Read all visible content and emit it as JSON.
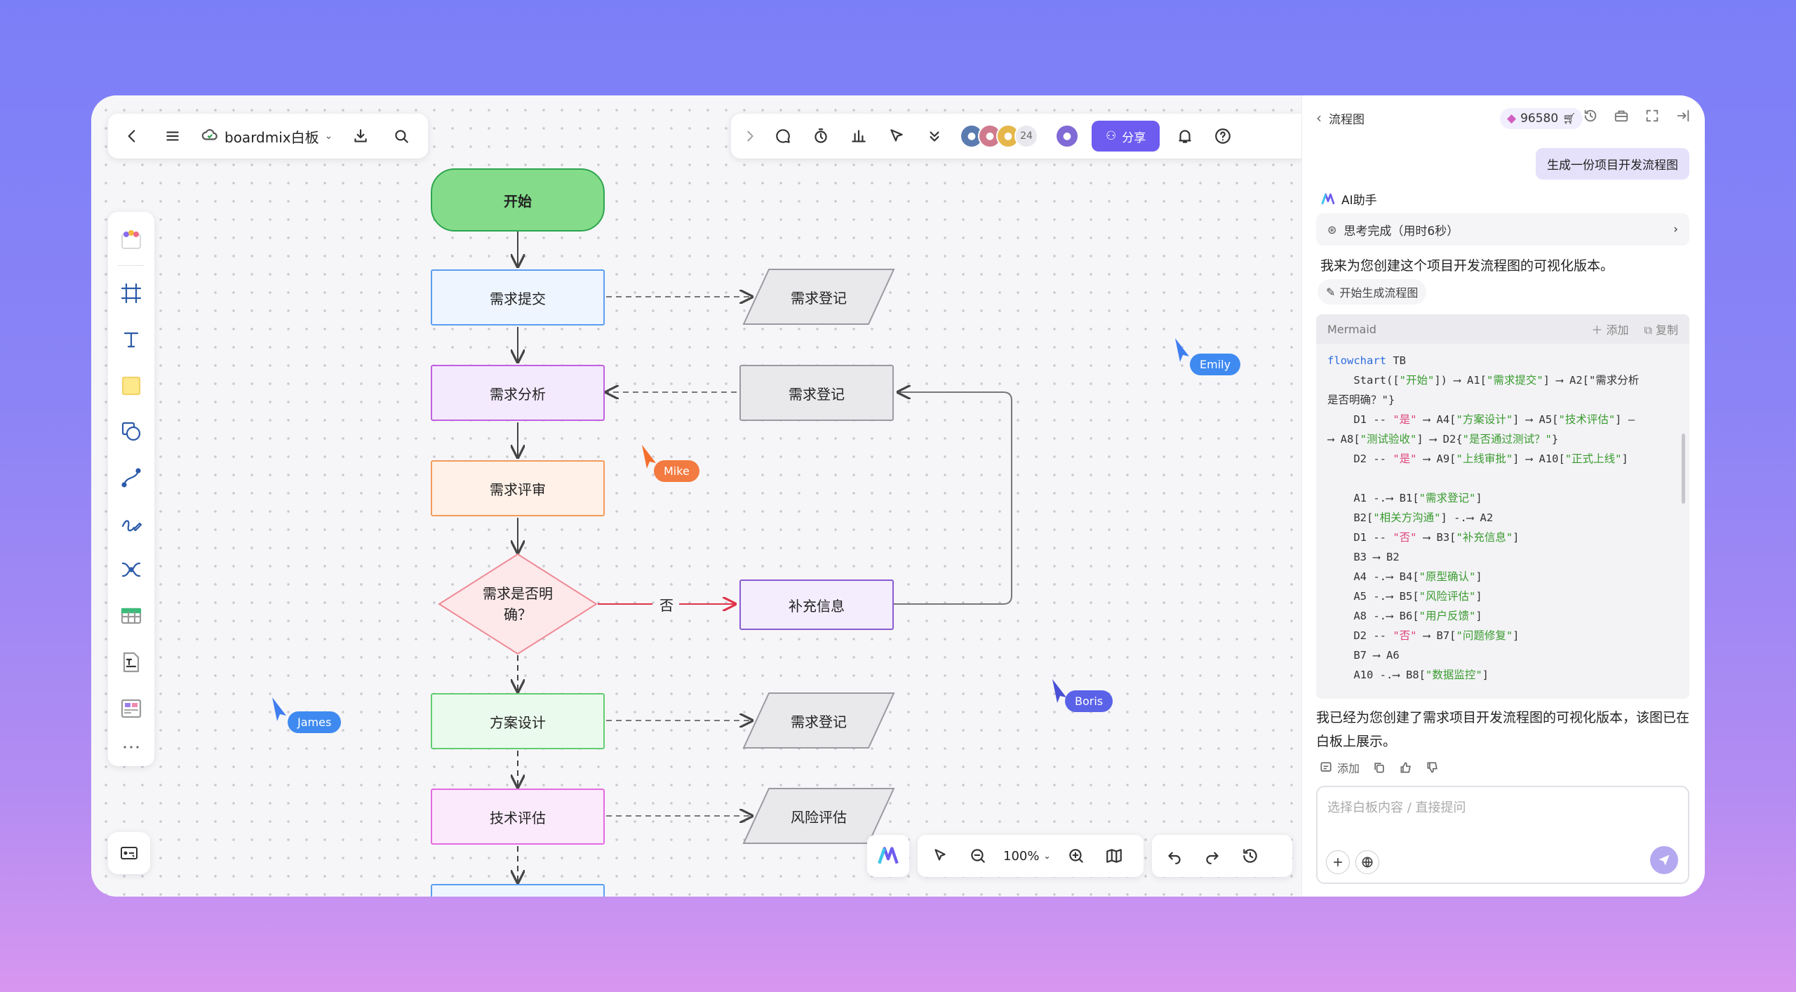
{
  "toolbar": {
    "board_name": "boardmix白板",
    "share_label": "分享",
    "collab_count": "24"
  },
  "zoom": {
    "level": "100%"
  },
  "flowchart": {
    "start": "开始",
    "a1": "需求提交",
    "a2": "需求分析",
    "a3": "需求评审",
    "d1": "需求是否明\n确？",
    "a4": "方案设计",
    "a5": "技术评估",
    "b1": "需求登记",
    "b2": "需求登记",
    "b3": "补充信息",
    "b4": "需求登记",
    "b5": "风险评估",
    "edge_no": "否"
  },
  "cursors": {
    "emily": "Emily",
    "mike": "Mike",
    "boris": "Boris",
    "james": "James"
  },
  "panel": {
    "title": "流程图",
    "credits": "96580",
    "user_message": "生成一份项目开发流程图",
    "ai_name": "AI助手",
    "thinking": "思考完成（用时6秒）",
    "intro": "我来为您创建这个项目开发流程图的可视化版本。",
    "gen_chip": "开始生成流程图",
    "code_lang": "Mermaid",
    "code_add": "添加",
    "code_copy": "复制",
    "code_lines": [
      "flowchart TB",
      "    Start([\"开始\"]) ⟶ A1[\"需求提交\"] ⟶ A2[\"需求分析",
      "是否明确？\"}",
      "    D1 -- \"是\" ⟶ A4[\"方案设计\"] ⟶ A5[\"技术评估\"] –",
      "⟶ A8[\"测试验收\"] ⟶ D2{\"是否通过测试？\"}",
      "    D2 -- \"是\" ⟶ A9[\"上线审批\"] ⟶ A10[\"正式上线\"]",
      "",
      "    A1 -.⟶ B1[\"需求登记\"]",
      "    B2[\"相关方沟通\"] -.⟶ A2",
      "    D1 -- \"否\" ⟶ B3[\"补充信息\"]",
      "    B3 ⟶ B2",
      "    A4 -.⟶ B4[\"原型确认\"]",
      "    A5 -.⟶ B5[\"风险评估\"]",
      "    A8 -.⟶ B6[\"用户反馈\"]",
      "    D2 -- \"否\" ⟶ B7[\"问题修复\"]",
      "    B7 ⟶ A6",
      "    A10 -.⟶ B8[\"数据监控\"]"
    ],
    "result": "我已经为您创建了需求项目开发流程图的可视化版本，该图已在白板上展示。",
    "action_add": "添加",
    "input_placeholder": "选择白板内容 / 直接提问"
  },
  "colors": {
    "accent": "#6e5cf0",
    "start_fill": "#84dc8a",
    "decision_stroke": "#f08a95"
  }
}
